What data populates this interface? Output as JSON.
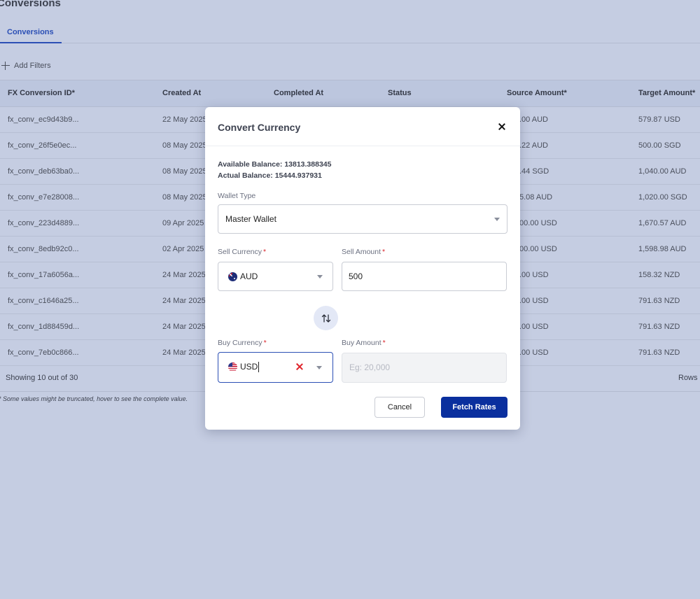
{
  "page": {
    "title": "Conversions",
    "tab": "Conversions",
    "add_filters": "Add Filters"
  },
  "table": {
    "columns": [
      "FX Conversion ID*",
      "Created At",
      "Completed At",
      "Status",
      "Source Amount*",
      "Target Amount*"
    ],
    "rows": [
      {
        "id": "fx_conv_ec9d43b9...",
        "created": "22 May 2025",
        "source": ".00 AUD",
        "target": "579.87 USD"
      },
      {
        "id": "fx_conv_26f5e0ec...",
        "created": "08 May 2025",
        "source": ".22 AUD",
        "target": "500.00 SGD"
      },
      {
        "id": "fx_conv_deb63ba0...",
        "created": "08 May 2025",
        "source": ".44 SGD",
        "target": "1,040.00 AUD"
      },
      {
        "id": "fx_conv_e7e28008...",
        "created": "08 May 2025",
        "source": "5.08 AUD",
        "target": "1,020.00 SGD"
      },
      {
        "id": "fx_conv_223d4889...",
        "created": "09 Apr 2025",
        "source": "00.00 USD",
        "target": "1,670.57 AUD"
      },
      {
        "id": "fx_conv_8edb92c0...",
        "created": "02 Apr 2025",
        "source": "00.00 USD",
        "target": "1,598.98 AUD"
      },
      {
        "id": "fx_conv_17a6056a...",
        "created": "24 Mar 2025",
        "source": ".00 USD",
        "target": "158.32 NZD"
      },
      {
        "id": "fx_conv_c1646a25...",
        "created": "24 Mar 2025",
        "source": ".00 USD",
        "target": "791.63 NZD"
      },
      {
        "id": "fx_conv_1d88459d...",
        "created": "24 Mar 2025",
        "source": ".00 USD",
        "target": "791.63 NZD"
      },
      {
        "id": "fx_conv_7eb0c866...",
        "created": "24 Mar 2025",
        "source": ".00 USD",
        "target": "791.63 NZD"
      }
    ],
    "showing": "Showing 10 out of 30",
    "rows_label": "Rows",
    "note": "* Some values might be truncated, hover to see the complete value."
  },
  "modal": {
    "title": "Convert Currency",
    "available_balance": "Available Balance: 13813.388345",
    "actual_balance": "Actual Balance: 15444.937931",
    "wallet_type_label": "Wallet Type",
    "wallet_type_value": "Master Wallet",
    "sell_currency_label": "Sell Currency",
    "sell_currency_value": "AUD",
    "sell_amount_label": "Sell Amount",
    "sell_amount_value": "500",
    "buy_currency_label": "Buy Currency",
    "buy_currency_value": "USD",
    "buy_amount_label": "Buy Amount",
    "buy_amount_placeholder": "Eg: 20,000",
    "required_mark": "*",
    "cancel_label": "Cancel",
    "fetch_label": "Fetch Rates"
  },
  "icons": {
    "close": "close-icon",
    "swap": "swap-arrows-icon",
    "clear": "clear-icon",
    "caret": "chevron-down-icon",
    "plus": "plus-icon"
  },
  "colors": {
    "accent": "#2b4fb5",
    "primary_button": "#0a2f9e",
    "required": "#d9252b",
    "backdrop": "#c5cde2"
  }
}
